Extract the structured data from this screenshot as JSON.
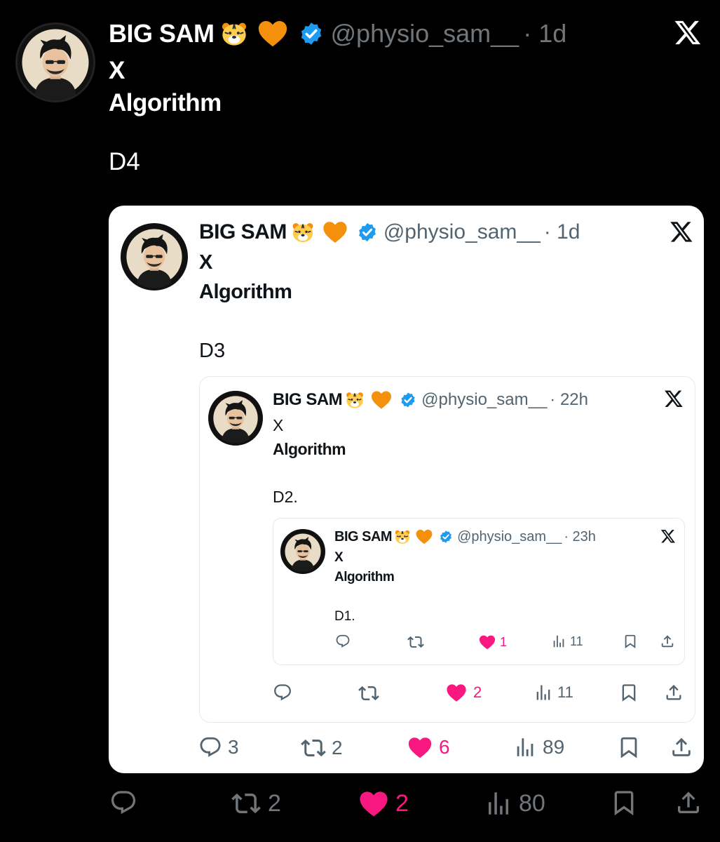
{
  "outer": {
    "name": "BIG SAM",
    "handle": "@physio_sam__",
    "time": "· 1d",
    "line1": "X",
    "line2": "Algorithm",
    "body": "D4",
    "actions": {
      "replies": "",
      "reposts": "2",
      "likes": "2",
      "views": "80"
    }
  },
  "quote1": {
    "name": "BIG SAM",
    "handle": "@physio_sam__",
    "time": "· 1d",
    "line1": "X",
    "line2": "Algorithm",
    "body": "D3",
    "actions": {
      "replies": "3",
      "reposts": "2",
      "likes": "6",
      "views": "89"
    }
  },
  "quote2": {
    "name": "BIG SAM",
    "handle": "@physio_sam__",
    "time": "· 22h",
    "line1": "X",
    "line2": "Algorithm",
    "body": "D2.",
    "actions": {
      "replies": "",
      "reposts": "",
      "likes": "2",
      "views": "11"
    }
  },
  "quote3": {
    "name": "BIG SAM",
    "handle": "@physio_sam__",
    "time": "· 23h",
    "line1": "X",
    "line2": "Algorithm",
    "body": "D1.",
    "actions": {
      "replies": "",
      "reposts": "",
      "likes": "1",
      "views": "11"
    }
  },
  "icons": {
    "verified": "verified-badge-icon",
    "tiger": "tiger-emoji",
    "heart_emoji": "orange-heart-emoji",
    "platform": "x-logo-icon"
  },
  "colors": {
    "background": "#000000",
    "card": "#ffffff",
    "like": "#f91880",
    "verified": "#1d9bf0",
    "orange_heart": "#f4900c",
    "muted_dark": "#71767b",
    "muted_light": "#536471"
  }
}
